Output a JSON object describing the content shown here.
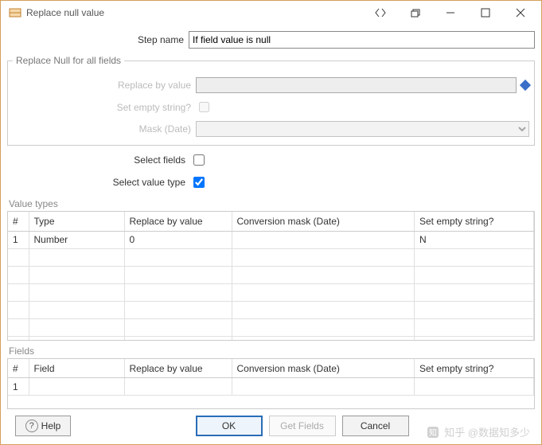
{
  "window": {
    "title": "Replace null value"
  },
  "form": {
    "step_name_label": "Step name",
    "step_name_value": "If field value is null"
  },
  "group": {
    "legend": "Replace Null for all fields",
    "replace_by_value_label": "Replace by value",
    "replace_by_value": "",
    "set_empty_label": "Set empty string?",
    "mask_label": "Mask (Date)",
    "mask_value": ""
  },
  "checks": {
    "select_fields_label": "Select fields",
    "select_fields": false,
    "select_value_type_label": "Select value type",
    "select_value_type": true
  },
  "value_types": {
    "section_label": "Value types",
    "headers": {
      "num": "#",
      "type": "Type",
      "replace": "Replace by value",
      "mask": "Conversion mask (Date)",
      "empty": "Set empty string?"
    },
    "rows": [
      {
        "num": "1",
        "type": "Number",
        "replace": "0",
        "mask": "",
        "empty": "N"
      }
    ]
  },
  "fields": {
    "section_label": "Fields",
    "headers": {
      "num": "#",
      "field": "Field",
      "replace": "Replace by value",
      "mask": "Conversion mask (Date)",
      "empty": "Set empty string?"
    },
    "rows": [
      {
        "num": "1",
        "field": "",
        "replace": "",
        "mask": "",
        "empty": ""
      }
    ]
  },
  "buttons": {
    "help": "Help",
    "ok": "OK",
    "get_fields": "Get Fields",
    "cancel": "Cancel"
  },
  "watermark": "知乎 @数据知多少"
}
